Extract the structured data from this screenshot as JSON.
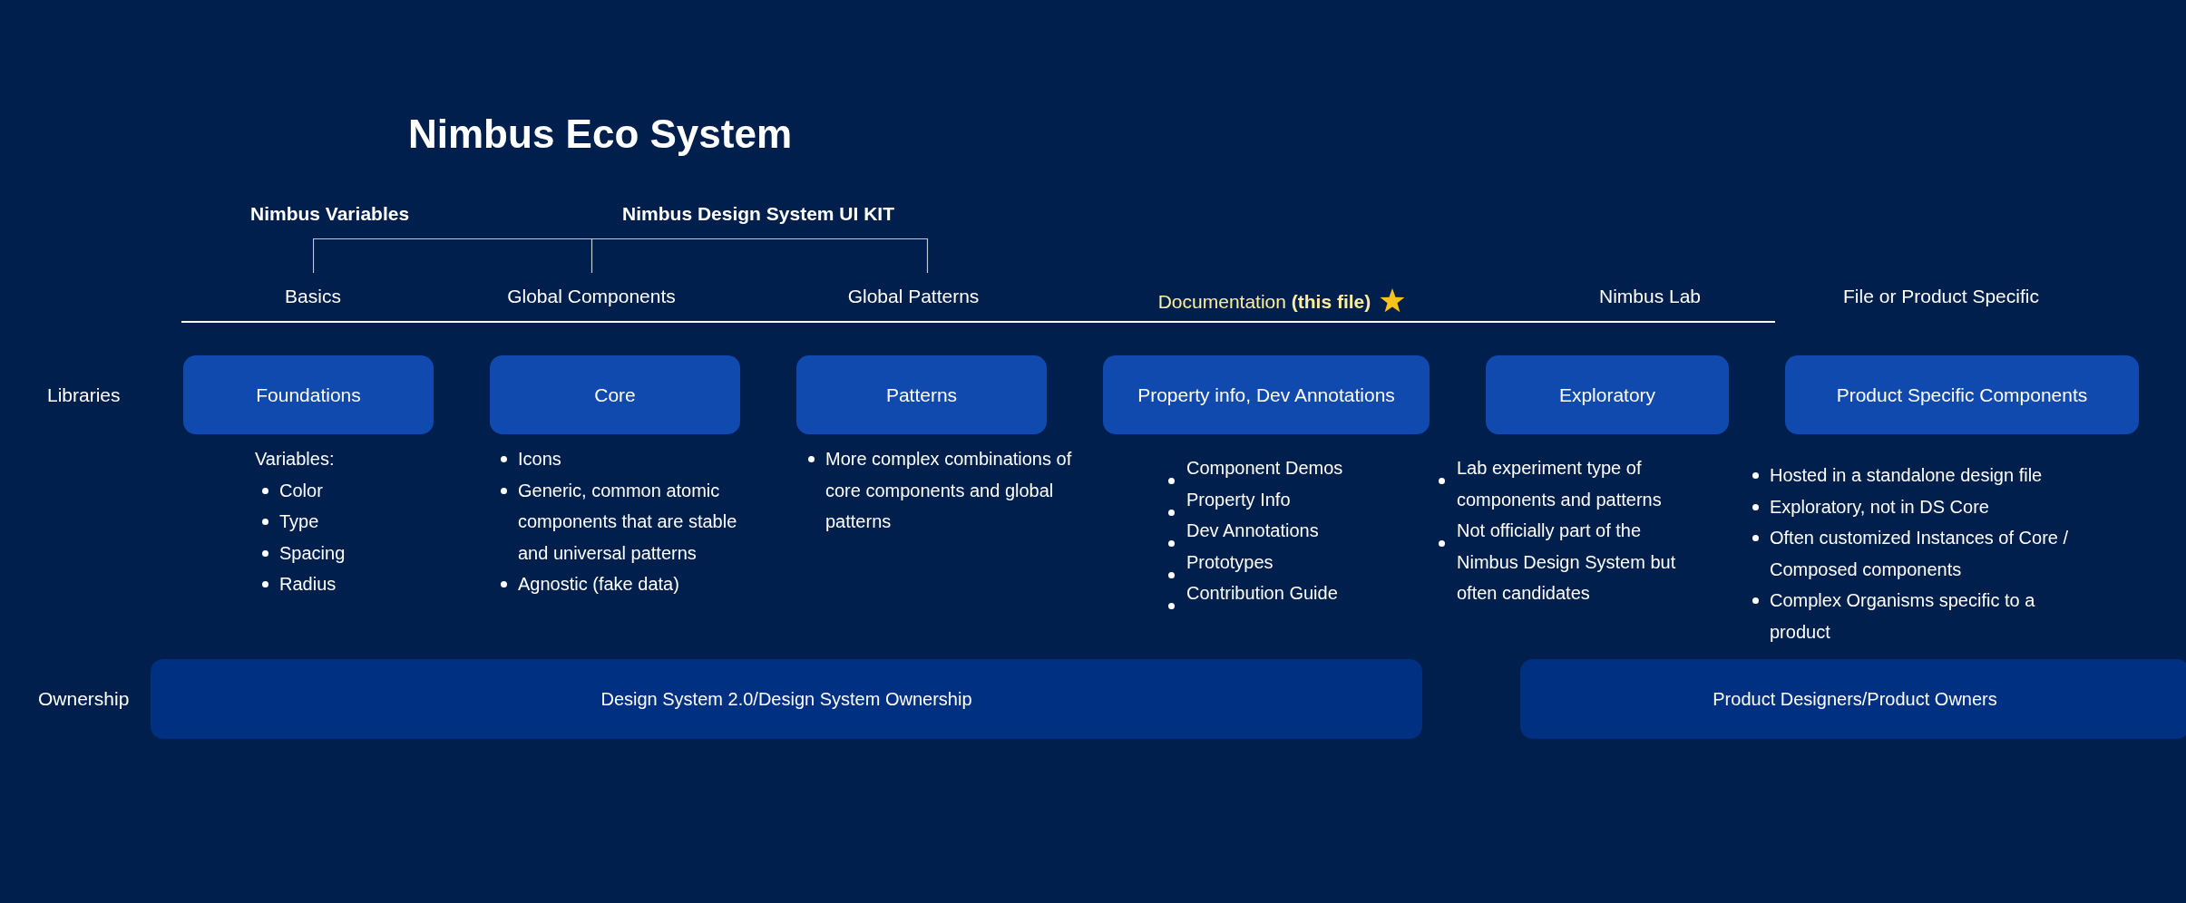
{
  "title": "Nimbus Eco System",
  "groups": [
    {
      "label": "Nimbus Variables"
    },
    {
      "label": "Nimbus Design System UI KIT"
    }
  ],
  "categories": [
    {
      "label": "Basics",
      "starred": false
    },
    {
      "label": "Global Components",
      "starred": false
    },
    {
      "label": "Global Patterns",
      "starred": false
    },
    {
      "label": "Documentation **(this file)**",
      "starred": true
    },
    {
      "label": "Nimbus Lab",
      "starred": false
    },
    {
      "label": "File or Product Specific",
      "starred": false
    }
  ],
  "libraries": {
    "label": "Libraries",
    "items": [
      {
        "name": "Foundations",
        "intro": "Variables:",
        "notes": [
          "Color",
          "Type",
          "Spacing",
          "Radius"
        ]
      },
      {
        "name": "Core",
        "notes": [
          "Icons",
          "Generic, common atomic components that are stable and universal patterns",
          "Agnostic (fake data)"
        ]
      },
      {
        "name": "Patterns",
        "notes": [
          "More complex combinations of core components and global patterns"
        ]
      },
      {
        "name": "Property info, Dev Annotations",
        "notes": [
          "Component Demos",
          "Property Info",
          "Dev Annotations",
          "Prototypes",
          "Contribution Guide"
        ]
      },
      {
        "name": "Exploratory",
        "notes": [
          "Lab experiment type of components and patterns",
          "Not officially part of the Nimbus Design System but often candidates"
        ]
      },
      {
        "name": "Product Specific Components",
        "notes": [
          "Hosted in a standalone design file",
          "Exploratory, not in DS Core",
          "Often customized Instances of Core / Composed components",
          "Complex Organisms specific to a product"
        ]
      }
    ]
  },
  "ownership": {
    "label": "Ownership",
    "owners": [
      "Design System 2.0/Design System Ownership",
      "Product Designers/Product Owners"
    ]
  }
}
